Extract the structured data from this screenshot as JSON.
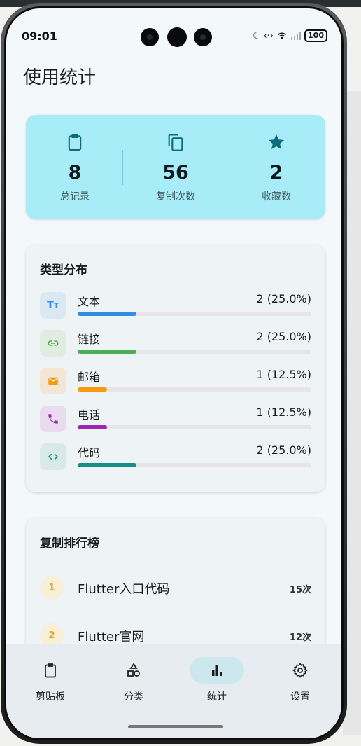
{
  "status": {
    "time": "09:01",
    "battery": "100"
  },
  "page": {
    "title": "使用统计"
  },
  "summary": {
    "items": [
      {
        "value": "8",
        "label": "总记录",
        "icon": "clipboard-icon"
      },
      {
        "value": "56",
        "label": "复制次数",
        "icon": "copy-icon"
      },
      {
        "value": "2",
        "label": "收藏数",
        "icon": "star-icon"
      }
    ],
    "color": "#a8ecf8",
    "icon_color": "#0e6b7a"
  },
  "distribution": {
    "title": "类型分布",
    "items": [
      {
        "name": "文本",
        "value": "2 (25.0%)",
        "fraction": 0.25,
        "color": "#2f8fe6",
        "bg": "#dbe8f3",
        "icon": "text-icon"
      },
      {
        "name": "链接",
        "value": "2 (25.0%)",
        "fraction": 0.25,
        "color": "#4caf50",
        "bg": "#e0ecdf",
        "icon": "link-icon"
      },
      {
        "name": "邮箱",
        "value": "1 (12.5%)",
        "fraction": 0.125,
        "color": "#f59b12",
        "bg": "#f3e6d5",
        "icon": "email-icon"
      },
      {
        "name": "电话",
        "value": "1 (12.5%)",
        "fraction": 0.125,
        "color": "#9c27b0",
        "bg": "#eadcee",
        "icon": "phone-icon"
      },
      {
        "name": "代码",
        "value": "2 (25.0%)",
        "fraction": 0.25,
        "color": "#138f86",
        "bg": "#d8eae8",
        "icon": "code-icon"
      }
    ]
  },
  "ranking": {
    "title": "复制排行榜",
    "items": [
      {
        "rank": "1",
        "name": "Flutter入口代码",
        "count": "15次"
      },
      {
        "rank": "2",
        "name": "Flutter官网",
        "count": "12次"
      }
    ]
  },
  "nav": {
    "items": [
      {
        "label": "剪贴板",
        "icon": "clipboard-icon",
        "active": false
      },
      {
        "label": "分类",
        "icon": "category-shapes-icon",
        "active": false
      },
      {
        "label": "统计",
        "icon": "bar-chart-icon",
        "active": true
      },
      {
        "label": "设置",
        "icon": "gear-icon",
        "active": false
      }
    ]
  }
}
